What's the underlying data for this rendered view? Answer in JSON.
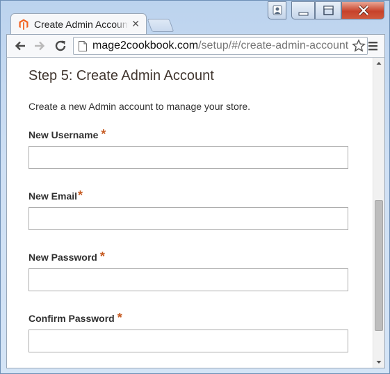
{
  "browser": {
    "tab": {
      "title": "Create Admin Account",
      "favicon": "magento-logo-icon",
      "close_icon": "close-icon"
    },
    "window_controls": [
      "user-icon",
      "minimize-icon",
      "maximize-icon",
      "close-icon"
    ],
    "toolbar": {
      "back_icon": "back-arrow-icon",
      "forward_icon": "forward-arrow-icon",
      "reload_icon": "reload-icon",
      "url_host": "mage2cookbook.com",
      "url_path": "/setup/#/create-admin-account",
      "bookmark_icon": "star-icon",
      "menu_icon": "hamburger-menu-icon"
    }
  },
  "page": {
    "step_title": "Step 5: Create Admin Account",
    "intro": "Create a new Admin account to manage your store.",
    "required_mark": "*",
    "fields": [
      {
        "label": "New Username",
        "value": ""
      },
      {
        "label": "New Email",
        "value": ""
      },
      {
        "label": "New Password",
        "value": ""
      },
      {
        "label": "Confirm Password",
        "value": ""
      }
    ]
  },
  "colors": {
    "required": "#c65b22",
    "heading": "#41362f",
    "magento_orange": "#f26322"
  }
}
